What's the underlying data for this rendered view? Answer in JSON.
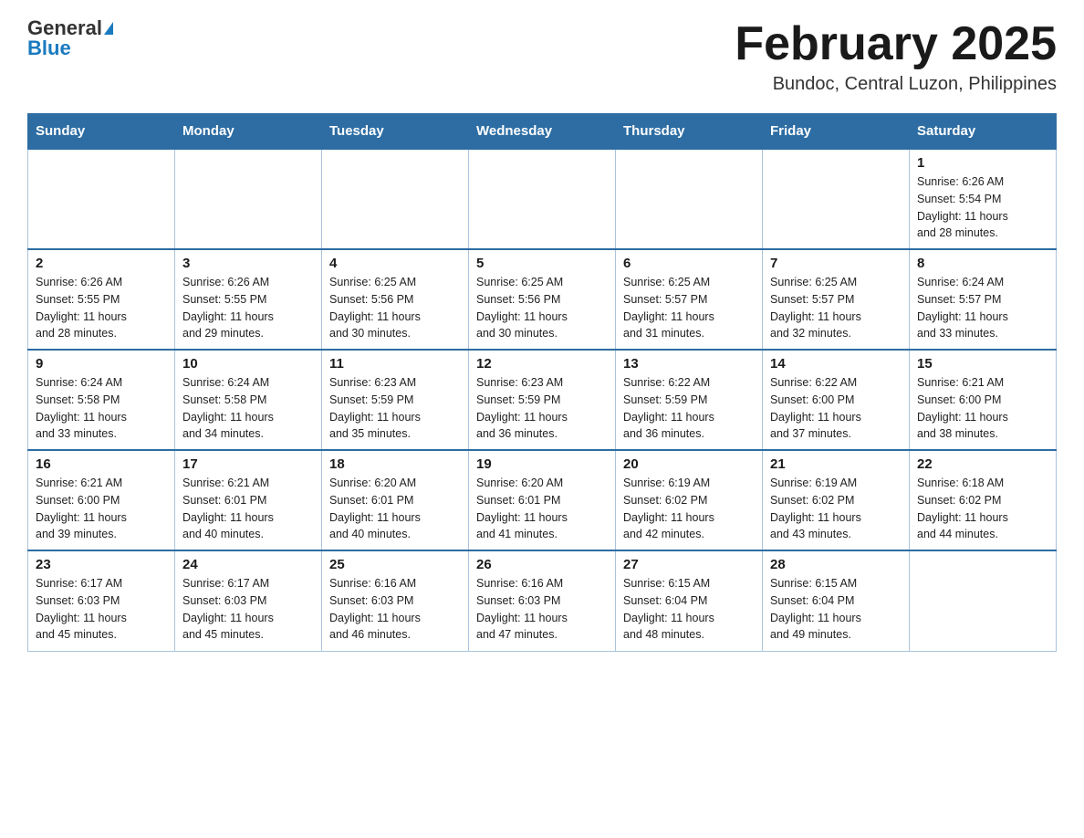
{
  "logo": {
    "general": "General",
    "blue": "Blue"
  },
  "title": "February 2025",
  "subtitle": "Bundoc, Central Luzon, Philippines",
  "days_header": [
    "Sunday",
    "Monday",
    "Tuesday",
    "Wednesday",
    "Thursday",
    "Friday",
    "Saturday"
  ],
  "weeks": [
    [
      {
        "num": "",
        "info": ""
      },
      {
        "num": "",
        "info": ""
      },
      {
        "num": "",
        "info": ""
      },
      {
        "num": "",
        "info": ""
      },
      {
        "num": "",
        "info": ""
      },
      {
        "num": "",
        "info": ""
      },
      {
        "num": "1",
        "info": "Sunrise: 6:26 AM\nSunset: 5:54 PM\nDaylight: 11 hours\nand 28 minutes."
      }
    ],
    [
      {
        "num": "2",
        "info": "Sunrise: 6:26 AM\nSunset: 5:55 PM\nDaylight: 11 hours\nand 28 minutes."
      },
      {
        "num": "3",
        "info": "Sunrise: 6:26 AM\nSunset: 5:55 PM\nDaylight: 11 hours\nand 29 minutes."
      },
      {
        "num": "4",
        "info": "Sunrise: 6:25 AM\nSunset: 5:56 PM\nDaylight: 11 hours\nand 30 minutes."
      },
      {
        "num": "5",
        "info": "Sunrise: 6:25 AM\nSunset: 5:56 PM\nDaylight: 11 hours\nand 30 minutes."
      },
      {
        "num": "6",
        "info": "Sunrise: 6:25 AM\nSunset: 5:57 PM\nDaylight: 11 hours\nand 31 minutes."
      },
      {
        "num": "7",
        "info": "Sunrise: 6:25 AM\nSunset: 5:57 PM\nDaylight: 11 hours\nand 32 minutes."
      },
      {
        "num": "8",
        "info": "Sunrise: 6:24 AM\nSunset: 5:57 PM\nDaylight: 11 hours\nand 33 minutes."
      }
    ],
    [
      {
        "num": "9",
        "info": "Sunrise: 6:24 AM\nSunset: 5:58 PM\nDaylight: 11 hours\nand 33 minutes."
      },
      {
        "num": "10",
        "info": "Sunrise: 6:24 AM\nSunset: 5:58 PM\nDaylight: 11 hours\nand 34 minutes."
      },
      {
        "num": "11",
        "info": "Sunrise: 6:23 AM\nSunset: 5:59 PM\nDaylight: 11 hours\nand 35 minutes."
      },
      {
        "num": "12",
        "info": "Sunrise: 6:23 AM\nSunset: 5:59 PM\nDaylight: 11 hours\nand 36 minutes."
      },
      {
        "num": "13",
        "info": "Sunrise: 6:22 AM\nSunset: 5:59 PM\nDaylight: 11 hours\nand 36 minutes."
      },
      {
        "num": "14",
        "info": "Sunrise: 6:22 AM\nSunset: 6:00 PM\nDaylight: 11 hours\nand 37 minutes."
      },
      {
        "num": "15",
        "info": "Sunrise: 6:21 AM\nSunset: 6:00 PM\nDaylight: 11 hours\nand 38 minutes."
      }
    ],
    [
      {
        "num": "16",
        "info": "Sunrise: 6:21 AM\nSunset: 6:00 PM\nDaylight: 11 hours\nand 39 minutes."
      },
      {
        "num": "17",
        "info": "Sunrise: 6:21 AM\nSunset: 6:01 PM\nDaylight: 11 hours\nand 40 minutes."
      },
      {
        "num": "18",
        "info": "Sunrise: 6:20 AM\nSunset: 6:01 PM\nDaylight: 11 hours\nand 40 minutes."
      },
      {
        "num": "19",
        "info": "Sunrise: 6:20 AM\nSunset: 6:01 PM\nDaylight: 11 hours\nand 41 minutes."
      },
      {
        "num": "20",
        "info": "Sunrise: 6:19 AM\nSunset: 6:02 PM\nDaylight: 11 hours\nand 42 minutes."
      },
      {
        "num": "21",
        "info": "Sunrise: 6:19 AM\nSunset: 6:02 PM\nDaylight: 11 hours\nand 43 minutes."
      },
      {
        "num": "22",
        "info": "Sunrise: 6:18 AM\nSunset: 6:02 PM\nDaylight: 11 hours\nand 44 minutes."
      }
    ],
    [
      {
        "num": "23",
        "info": "Sunrise: 6:17 AM\nSunset: 6:03 PM\nDaylight: 11 hours\nand 45 minutes."
      },
      {
        "num": "24",
        "info": "Sunrise: 6:17 AM\nSunset: 6:03 PM\nDaylight: 11 hours\nand 45 minutes."
      },
      {
        "num": "25",
        "info": "Sunrise: 6:16 AM\nSunset: 6:03 PM\nDaylight: 11 hours\nand 46 minutes."
      },
      {
        "num": "26",
        "info": "Sunrise: 6:16 AM\nSunset: 6:03 PM\nDaylight: 11 hours\nand 47 minutes."
      },
      {
        "num": "27",
        "info": "Sunrise: 6:15 AM\nSunset: 6:04 PM\nDaylight: 11 hours\nand 48 minutes."
      },
      {
        "num": "28",
        "info": "Sunrise: 6:15 AM\nSunset: 6:04 PM\nDaylight: 11 hours\nand 49 minutes."
      },
      {
        "num": "",
        "info": ""
      }
    ]
  ]
}
